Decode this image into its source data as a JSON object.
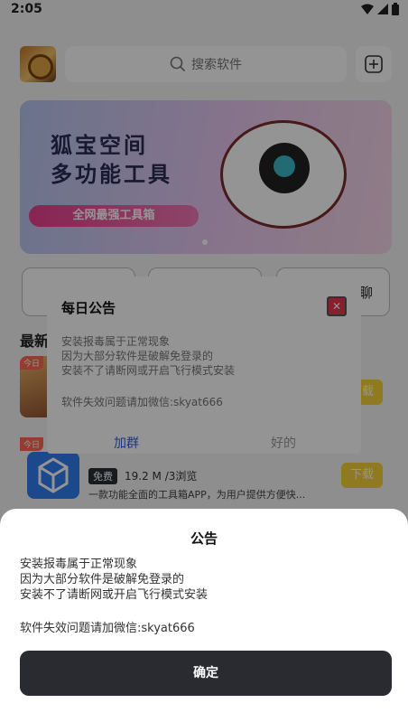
{
  "status_bar": {
    "time": "2:05"
  },
  "header": {
    "search_placeholder": "搜索软件"
  },
  "banner": {
    "title_line1": "狐宝空间",
    "title_line2": "多功能工具",
    "pill_text": "全网最强工具箱"
  },
  "tiles": [
    {
      "label": ""
    },
    {
      "label": ""
    },
    {
      "label": "聊"
    }
  ],
  "list": {
    "section_title": "最新",
    "today_badge": "今日",
    "apps": [
      {
        "download": "下载"
      },
      {
        "free_tag": "免费",
        "meta": "19.2 M /3浏览",
        "desc": "一款功能全面的工具箱APP，为用户提供方便快...",
        "download": "下载"
      }
    ]
  },
  "notice_card": {
    "title": "每日公告",
    "close_label": "✕",
    "lines": [
      "安装报毒属于正常现象",
      "因为大部分软件是破解免登录的",
      "安装不了请断网或开启飞行模式安装"
    ],
    "extra": "软件失效问题请加微信:skyat666",
    "buttons": [
      "加群",
      "好的"
    ]
  },
  "sheet": {
    "title": "公告",
    "lines": [
      "安装报毒属于正常现象",
      "因为大部分软件是破解免登录的",
      "安装不了请断网或开启飞行模式安装"
    ],
    "extra": "软件失效问题请加微信:skyat666",
    "confirm": "确定"
  }
}
